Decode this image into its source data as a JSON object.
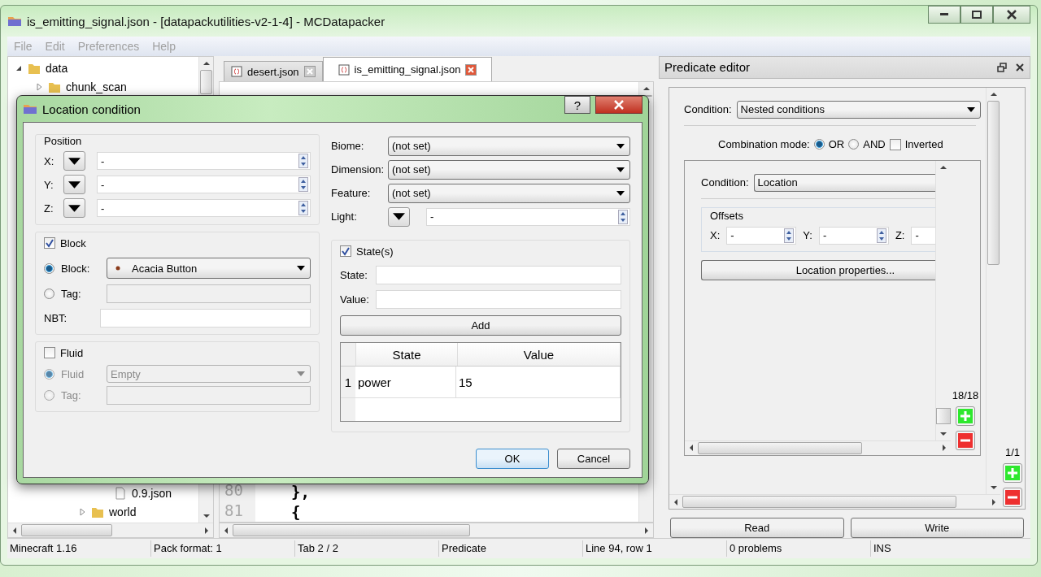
{
  "window": {
    "title": "is_emitting_signal.json - [datapackutilities-v2-1-4] - MCDatapacker"
  },
  "menu": [
    {
      "label": "File",
      "disabled": true
    },
    {
      "label": "Edit",
      "disabled": true
    },
    {
      "label": "Preferences",
      "disabled": true
    },
    {
      "label": "Help",
      "disabled": true
    }
  ],
  "tree": [
    {
      "label": "data",
      "kind": "folder",
      "expanded": true,
      "children": [
        {
          "label": "chunk_scan",
          "kind": "folder",
          "expanded": false
        }
      ]
    }
  ],
  "tree_bottom": [
    {
      "label": "0.9.json",
      "kind": "file"
    },
    {
      "label": "world",
      "kind": "folder",
      "expanded": false
    }
  ],
  "tabs": [
    {
      "label": "desert.json",
      "selected": false
    },
    {
      "label": "is_emitting_signal.json",
      "selected": true
    }
  ],
  "code_bottom": [
    {
      "number": "80",
      "text": "},"
    },
    {
      "number": "81",
      "text": "{"
    }
  ],
  "dialog": {
    "title": "Location condition",
    "help": "?",
    "position": {
      "title": "Position",
      "fields": [
        {
          "label": "X:",
          "value": "-"
        },
        {
          "label": "Y:",
          "value": "-"
        },
        {
          "label": "Z:",
          "value": "-"
        }
      ]
    },
    "selects": [
      {
        "label": "Biome:",
        "value": "(not set)"
      },
      {
        "label": "Dimension:",
        "value": "(not set)"
      },
      {
        "label": "Feature:",
        "value": "(not set)"
      }
    ],
    "light": {
      "label": "Light:",
      "value": "-"
    },
    "block": {
      "title": "Block",
      "checked": true,
      "radios": [
        {
          "label": "Block:",
          "selected": true,
          "value": "Acacia Button"
        },
        {
          "label": "Tag:",
          "selected": false
        }
      ],
      "nbt_label": "NBT:"
    },
    "fluid": {
      "title": "Fluid",
      "checked": false,
      "radios": [
        {
          "label": "Fluid",
          "selected": true,
          "value": "Empty"
        },
        {
          "label": "Tag:",
          "selected": false
        }
      ]
    },
    "states": {
      "title": "State(s)",
      "checked": true,
      "state_label": "State:",
      "value_label": "Value:",
      "add": "Add",
      "columns": [
        "State",
        "Value"
      ],
      "rows": [
        {
          "index": "1",
          "cells": [
            "power",
            "15"
          ]
        }
      ]
    },
    "buttons": [
      "OK",
      "Cancel"
    ]
  },
  "predicate_editor": {
    "title": "Predicate editor",
    "condition_label": "Condition:",
    "condition": "Nested conditions",
    "combination_label": "Combination mode:",
    "modes": [
      {
        "label": "OR",
        "selected": true
      },
      {
        "label": "AND",
        "selected": false
      }
    ],
    "inverted": {
      "label": "Inverted",
      "checked": false
    },
    "inner": {
      "condition_label": "Condition:",
      "condition": "Location",
      "offsets_title": "Offsets",
      "offsets": [
        {
          "label": "X:",
          "value": "-"
        },
        {
          "label": "Y:",
          "value": "-"
        },
        {
          "label": "Z:",
          "value": "-"
        }
      ],
      "properties_button": "Location properties...",
      "counter": "18/18"
    },
    "counter": "1/1",
    "buttons": [
      "Read",
      "Write"
    ]
  },
  "status_bar": [
    "Minecraft 1.16",
    "Pack format: 1",
    "Tab 2 / 2",
    "Predicate",
    "Line 94, row 1",
    "0 problems",
    "INS"
  ]
}
